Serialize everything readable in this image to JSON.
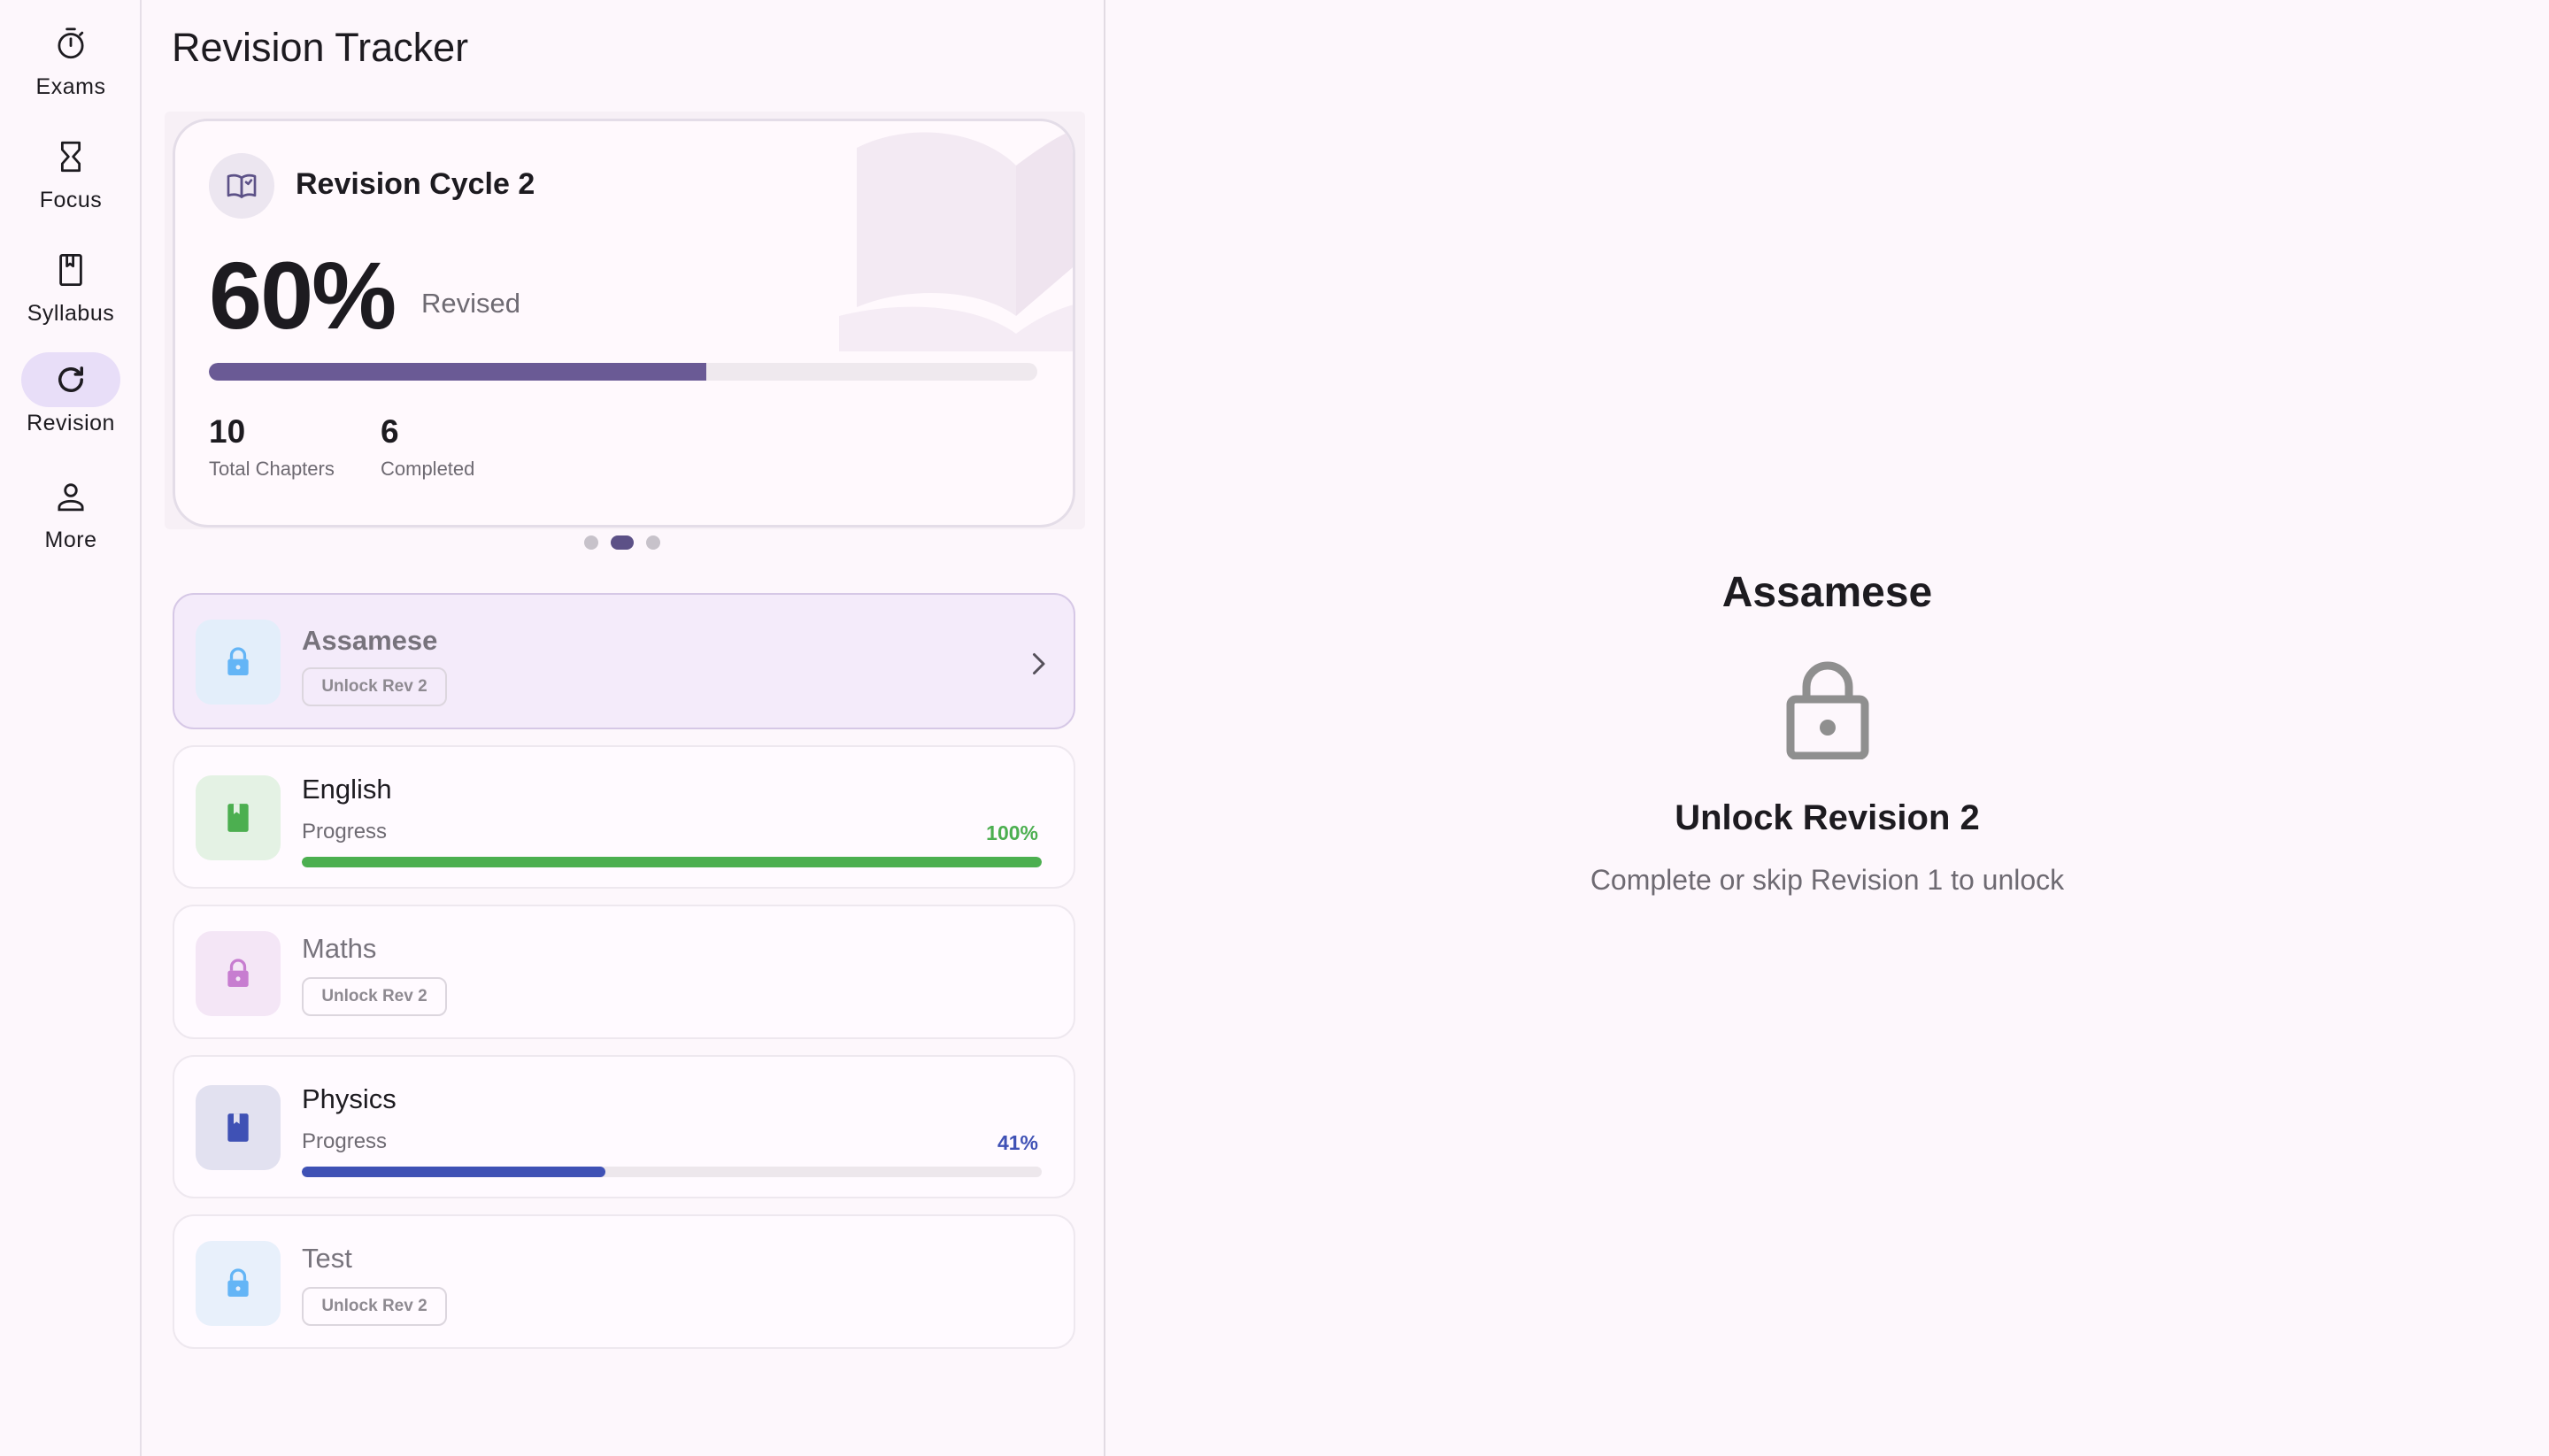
{
  "nav": {
    "items": [
      {
        "label": "Exams",
        "icon": "timer-icon",
        "active": false
      },
      {
        "label": "Focus",
        "icon": "hourglass-icon",
        "active": false
      },
      {
        "label": "Syllabus",
        "icon": "book-icon",
        "active": false
      },
      {
        "label": "Revision",
        "icon": "refresh-icon",
        "active": true
      },
      {
        "label": "More",
        "icon": "person-icon",
        "active": false
      }
    ]
  },
  "header": {
    "title": "Revision Tracker"
  },
  "hero": {
    "title": "Revision Cycle 2",
    "percent_text": "60%",
    "percent_value": 0.6,
    "revised_label": "Revised",
    "total_value": "10",
    "total_label": "Total Chapters",
    "completed_value": "6",
    "completed_label": "Completed",
    "accent": "#6a5a95",
    "carousel_pages": 3,
    "carousel_active": 2
  },
  "subjects": [
    {
      "name": "Assamese",
      "locked": true,
      "badge": "Unlock Rev 2",
      "icon": "lock-icon",
      "icon_color": "#64b5f6",
      "icon_bg": "#e3eefa",
      "selected": true
    },
    {
      "name": "English",
      "locked": false,
      "progress_label": "Progress",
      "progress_text": "100%",
      "progress_value": 1.0,
      "color": "#4caf50",
      "icon": "book-icon",
      "icon_bg": "#e4f2e4"
    },
    {
      "name": "Maths",
      "locked": true,
      "badge": "Unlock Rev 2",
      "icon": "lock-icon",
      "icon_color": "#c77dd0",
      "icon_bg": "#f4e6f6",
      "selected": false
    },
    {
      "name": "Physics",
      "locked": false,
      "progress_label": "Progress",
      "progress_text": "41%",
      "progress_value": 0.41,
      "color": "#3f51b5",
      "icon": "book-icon",
      "icon_bg": "#e2e1f0"
    },
    {
      "name": "Test",
      "locked": true,
      "badge": "Unlock Rev 2",
      "icon": "lock-icon",
      "icon_color": "#64b5f6",
      "icon_bg": "#e8f0fb",
      "selected": false
    }
  ],
  "detail": {
    "subject": "Assamese",
    "heading": "Unlock Revision 2",
    "message": "Complete or skip Revision 1 to unlock",
    "icon": "lock-icon"
  }
}
